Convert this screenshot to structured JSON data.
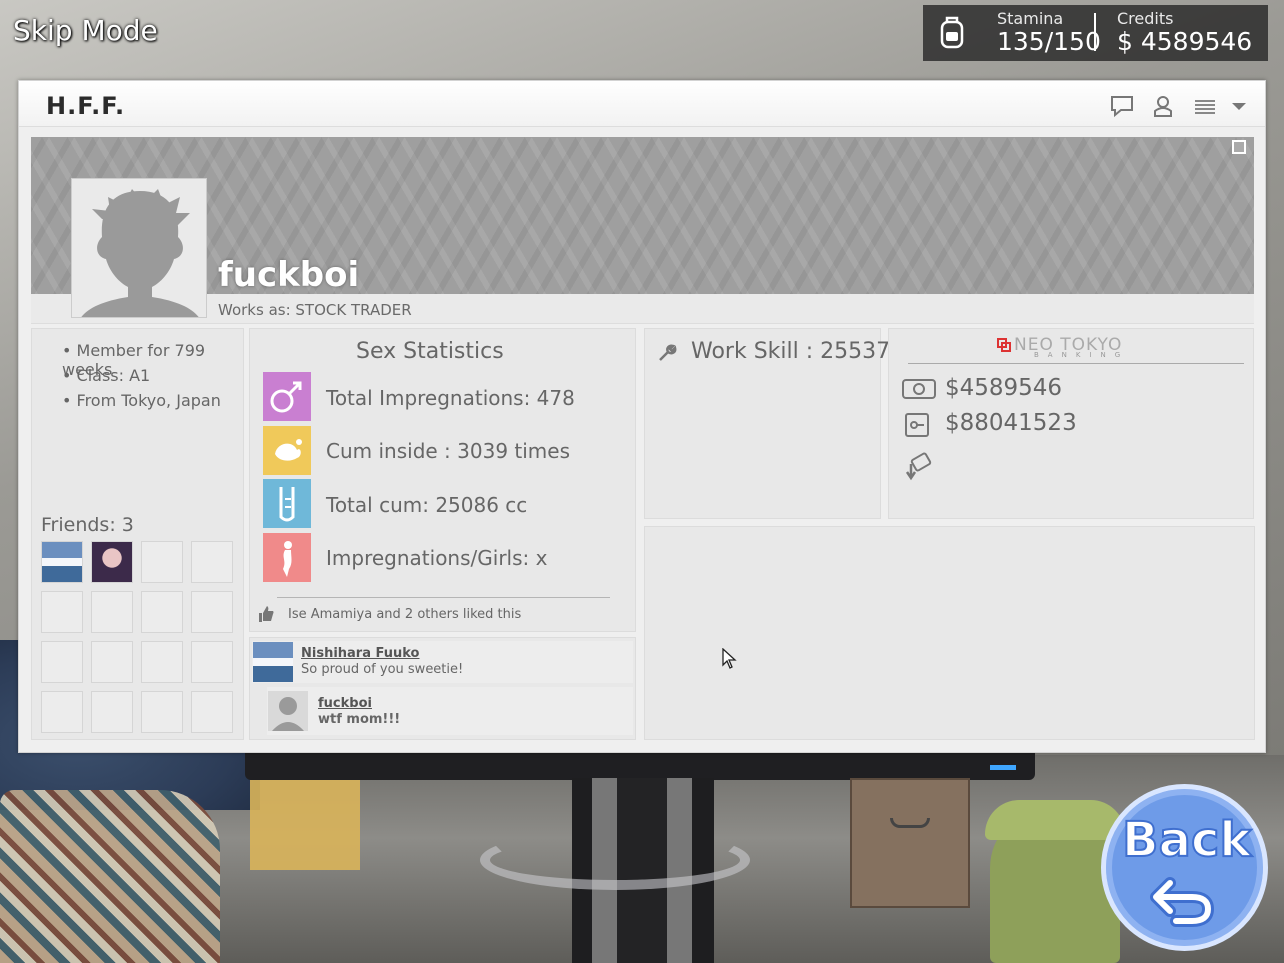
{
  "skip_mode": "Skip Mode",
  "hud": {
    "stamina_label": "Stamina",
    "stamina_value": "135/150",
    "credits_label": "Credits",
    "credits_value": "$ 4589546"
  },
  "app": {
    "logo": "H.F.F."
  },
  "profile": {
    "username": "fuckboi",
    "works_as": "Works as: STOCK TRADER",
    "info": [
      "• Member for 799 weeks",
      "• Class: A1",
      "• From Tokyo, Japan"
    ],
    "friends_label": "Friends: 3"
  },
  "stats": {
    "title": "Sex Statistics",
    "items": [
      {
        "label": "Total Impregnations: 478",
        "icon": "male-symbol-icon",
        "color": "#c97fd1"
      },
      {
        "label": "Cum inside : 3039 times",
        "icon": "splash-icon",
        "color": "#f0c95a"
      },
      {
        "label": "Total cum: 25086 cc",
        "icon": "test-tube-icon",
        "color": "#6fb8d9"
      },
      {
        "label": "Impregnations/Girls: x",
        "icon": "girl-silhouette-icon",
        "color": "#f08a8a"
      }
    ],
    "likes": "Ise Amamiya and 2 others liked this"
  },
  "comments": [
    {
      "name": "Nishihara Fuuko",
      "text": "So proud of you sweetie!"
    },
    {
      "name": "fuckboi",
      "text": "wtf mom!!!"
    }
  ],
  "work": {
    "label": "Work Skill : 25537"
  },
  "bank": {
    "name": "NEO TOKYO",
    "sub": "BANKING",
    "cash": "$4589546",
    "savings": "$88041523"
  },
  "back_button": "Back",
  "colors": {
    "back_blue": "#6e9be8",
    "panel": "#e8e8e8",
    "banner": "#9f9f9f"
  }
}
